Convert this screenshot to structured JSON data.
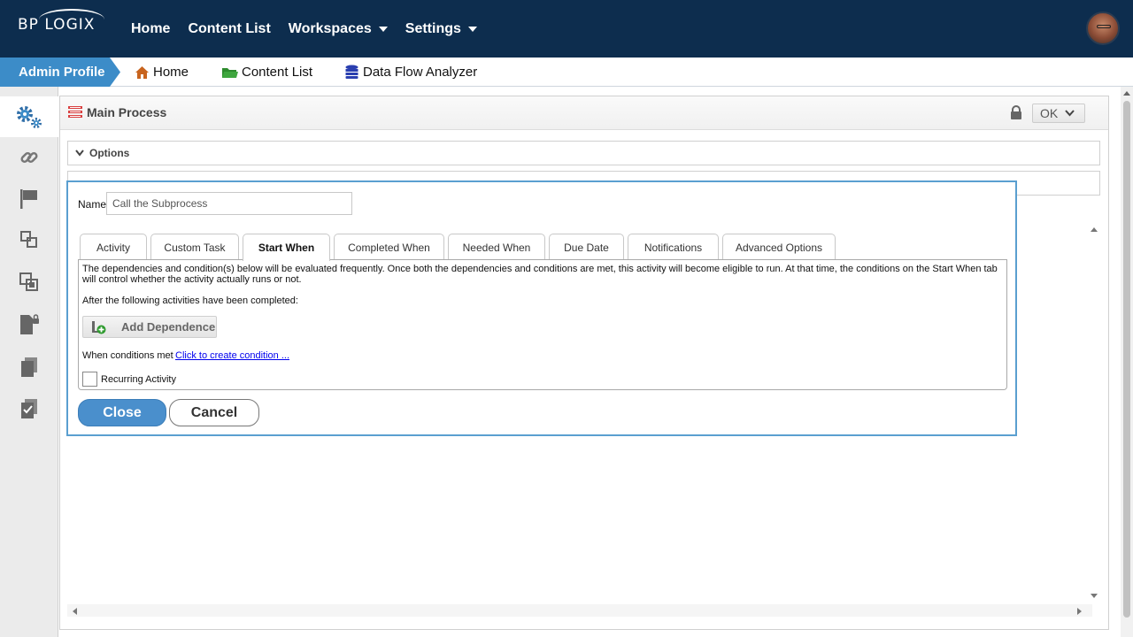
{
  "topbar": {
    "logo_text": "BP LOGIX",
    "nav": [
      {
        "label": "Home",
        "dropdown": false
      },
      {
        "label": "Content List",
        "dropdown": false
      },
      {
        "label": "Workspaces",
        "dropdown": true
      },
      {
        "label": "Settings",
        "dropdown": true
      }
    ]
  },
  "breadcrumb": {
    "profile": "Admin Profile",
    "items": [
      {
        "label": "Home",
        "icon": "home-icon"
      },
      {
        "label": "Content List",
        "icon": "folder-icon"
      },
      {
        "label": "Data Flow Analyzer",
        "icon": "database-icon"
      }
    ]
  },
  "sidebar": {
    "icons": [
      "gears-icon",
      "link-icon",
      "flag-icon",
      "layers-icon",
      "copy-icon",
      "locked-document-icon",
      "documents-icon",
      "checked-document-icon"
    ]
  },
  "panel": {
    "title": "Main Process",
    "ok_label": "OK",
    "sections": [
      {
        "label": "Options"
      }
    ]
  },
  "dialog": {
    "name_label": "Name",
    "name_value": "Call the Subprocess",
    "tabs": [
      {
        "label": "Activity"
      },
      {
        "label": "Custom Task"
      },
      {
        "label": "Start When"
      },
      {
        "label": "Completed When"
      },
      {
        "label": "Needed When"
      },
      {
        "label": "Due Date"
      },
      {
        "label": "Notifications"
      },
      {
        "label": "Advanced Options"
      }
    ],
    "active_tab": "Start When",
    "description": "The dependencies and condition(s) below will be evaluated frequently. Once both the dependencies and conditions are met, this activity will become eligible to run. At that time, the conditions on the Start When tab will control whether the activity actually runs or not.",
    "after_label": "After the following activities have been completed:",
    "add_dependence_label": "Add Dependence",
    "when_label": "When conditions met",
    "create_condition_link": "Click to create condition ...",
    "recurring_label": "Recurring Activity",
    "recurring_checked": false,
    "close_label": "Close",
    "cancel_label": "Cancel"
  },
  "colors": {
    "topbar": "#0d2d4e",
    "accent": "#3c8cc8",
    "dialog_border": "#5a9fd0"
  }
}
